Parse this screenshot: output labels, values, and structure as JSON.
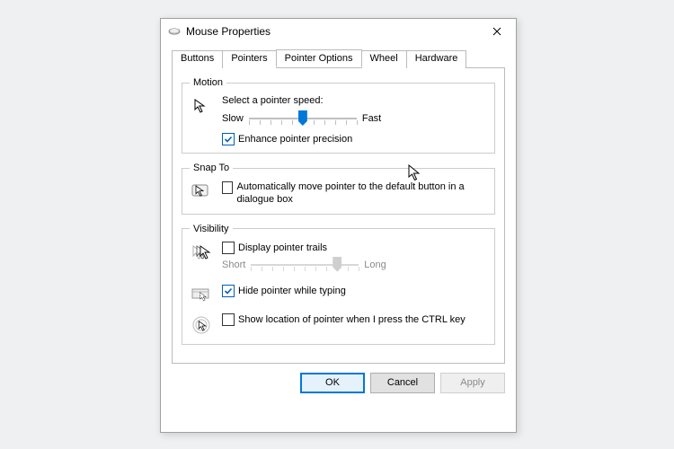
{
  "window": {
    "title": "Mouse Properties"
  },
  "tabs": [
    "Buttons",
    "Pointers",
    "Pointer Options",
    "Wheel",
    "Hardware"
  ],
  "activeTabIndex": 2,
  "motion": {
    "legend": "Motion",
    "speedLabel": "Select a pointer speed:",
    "slowLabel": "Slow",
    "fastLabel": "Fast",
    "speedValue": 6,
    "speedMax": 11,
    "enhanceLabel": "Enhance pointer precision",
    "enhanceChecked": true
  },
  "snapTo": {
    "legend": "Snap To",
    "autoLabel": "Automatically move pointer to the default button in a dialogue box",
    "autoChecked": false
  },
  "visibility": {
    "legend": "Visibility",
    "trailsLabel": "Display pointer trails",
    "trailsChecked": false,
    "trailsShort": "Short",
    "trailsLong": "Long",
    "trailsValue": 9,
    "trailsMax": 11,
    "trailsEnabled": false,
    "hideTypingLabel": "Hide pointer while typing",
    "hideTypingChecked": true,
    "ctrlLabel": "Show location of pointer when I press the CTRL key",
    "ctrlChecked": false
  },
  "buttons": {
    "ok": "OK",
    "cancel": "Cancel",
    "apply": "Apply"
  }
}
